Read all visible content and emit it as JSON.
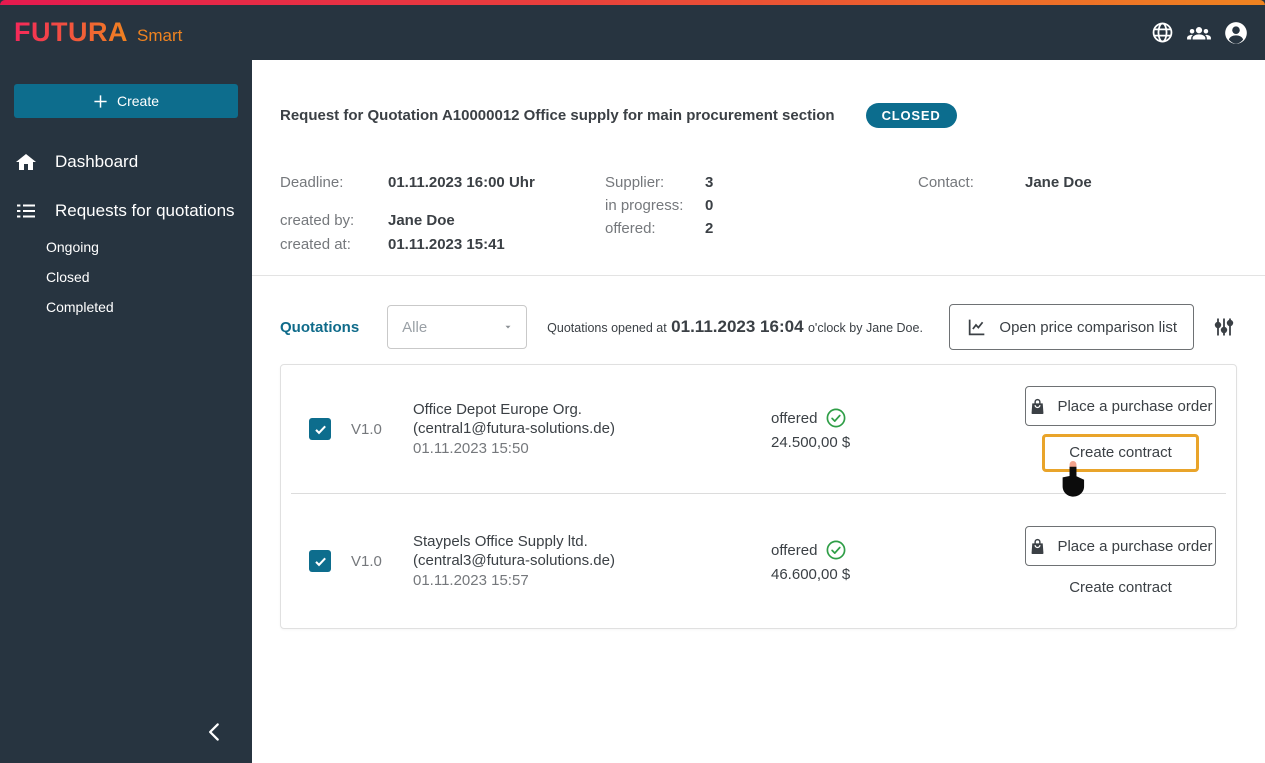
{
  "colors": {
    "topbar_bg": "#273440",
    "accent_teal": "#0d6d8d",
    "status_green": "#2f9e47",
    "annotation_orange": "#e9a42a",
    "strip_gradient_start": "#e51a4f",
    "strip_gradient_end": "#ef8320"
  },
  "brand": {
    "name": "FUTURA",
    "suffix": "Smart"
  },
  "topbar": {
    "icons": [
      "globe-icon",
      "users-icon",
      "account-circle-icon"
    ]
  },
  "sidebar": {
    "create_label": "Create",
    "items": [
      {
        "label": "Dashboard",
        "icon": "home-icon"
      },
      {
        "label": "Requests for quotations",
        "icon": "list-icon"
      }
    ],
    "subitems": [
      "Ongoing",
      "Closed",
      "Completed"
    ]
  },
  "header": {
    "title": "Request for Quotation A10000012 Office supply for main procurement section",
    "status": "CLOSED"
  },
  "details": {
    "deadline_label": "Deadline:",
    "deadline_value": "01.11.2023 16:00 Uhr",
    "created_by_label": "created by:",
    "created_by_value": "Jane Doe",
    "created_at_label": "created at:",
    "created_at_value": "01.11.2023 15:41",
    "supplier_label": "Supplier:",
    "supplier_value": "3",
    "in_progress_label": "in progress:",
    "in_progress_value": "0",
    "offered_label": "offered:",
    "offered_value": "2",
    "contact_label": "Contact:",
    "contact_value": "Jane Doe"
  },
  "quotations": {
    "section_label": "Quotations",
    "filter_value": "Alle",
    "opened_prefix": "Quotations opened at",
    "opened_time": "01.11.2023 16:04",
    "opened_suffix": "o'clock by Jane Doe.",
    "compare_button_label": "Open price comparison list",
    "rows": [
      {
        "version": "V1.0",
        "supplier": "Office Depot Europe Org.",
        "email": "(central1@futura-solutions.de)",
        "date": "01.11.2023 15:50",
        "status_label": "offered",
        "price": "24.500,00 $",
        "purchase_label": "Place a purchase order",
        "contract_label": "Create contract",
        "checked": true
      },
      {
        "version": "V1.0",
        "supplier": "Staypels Office Supply ltd.",
        "email": "(central3@futura-solutions.de)",
        "date": "01.11.2023 15:57",
        "status_label": "offered",
        "price": "46.600,00 $",
        "purchase_label": "Place a purchase order",
        "contract_label": "Create contract",
        "checked": true
      }
    ]
  }
}
